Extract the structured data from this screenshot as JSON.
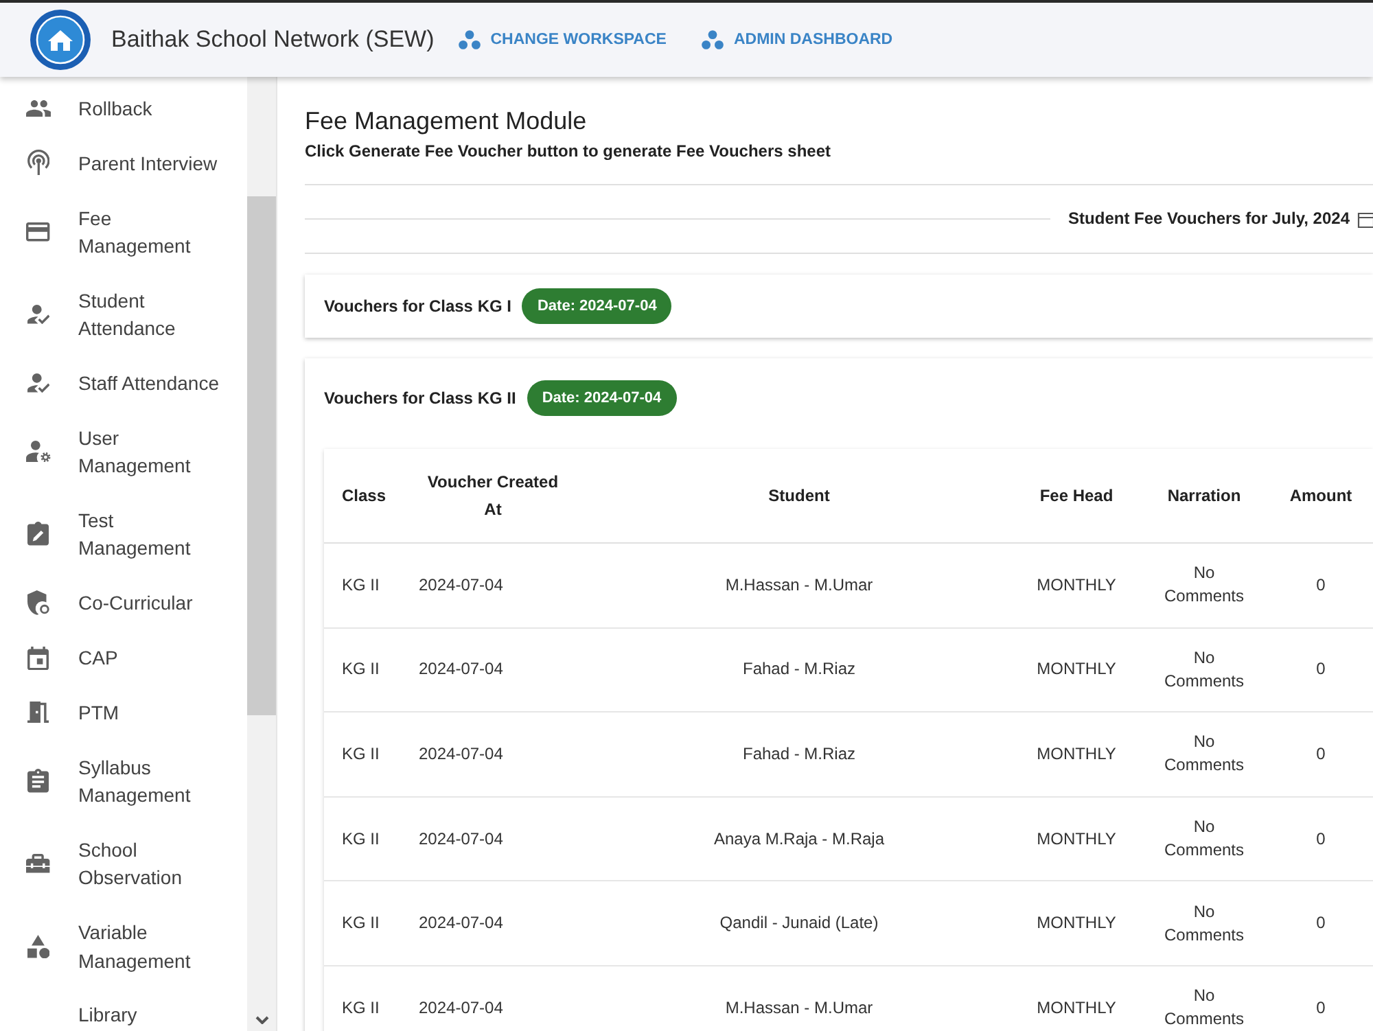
{
  "header": {
    "title": "Baithak School Network (SEW)",
    "actions": [
      {
        "label": "CHANGE WORKSPACE"
      },
      {
        "label": "ADMIN DASHBOARD"
      }
    ]
  },
  "sidebar": {
    "items": [
      {
        "label": "Rollback"
      },
      {
        "label": "Parent Interview"
      },
      {
        "label": "Fee Management"
      },
      {
        "label": "Student Attendance"
      },
      {
        "label": "Staff Attendance"
      },
      {
        "label": "User Management"
      },
      {
        "label": "Test Management"
      },
      {
        "label": "Co-Curricular"
      },
      {
        "label": "CAP"
      },
      {
        "label": "PTM"
      },
      {
        "label": "Syllabus Management"
      },
      {
        "label": "School Observation"
      },
      {
        "label": "Variable Management"
      },
      {
        "label": "Library"
      }
    ]
  },
  "page": {
    "title": "Fee Management Module",
    "subtitle": "Click Generate Fee Voucher button to generate Fee Vouchers sheet",
    "period_label": "Student Fee Vouchers for July, 2024"
  },
  "voucher_groups": [
    {
      "title": "Vouchers for Class KG I",
      "date": "Date: 2024-07-04"
    },
    {
      "title": "Vouchers for Class KG II",
      "date": "Date: 2024-07-04",
      "table": {
        "columns": [
          "Class",
          "Voucher Created At",
          "Student",
          "Fee Head",
          "Narration",
          "Amount"
        ],
        "rows": [
          [
            "KG II",
            "2024-07-04",
            "M.Hassan - M.Umar",
            "MONTHLY",
            "No Comments",
            "0"
          ],
          [
            "KG II",
            "2024-07-04",
            "Fahad - M.Riaz",
            "MONTHLY",
            "No Comments",
            "0"
          ],
          [
            "KG II",
            "2024-07-04",
            "Fahad - M.Riaz",
            "MONTHLY",
            "No Comments",
            "0"
          ],
          [
            "KG II",
            "2024-07-04",
            "Anaya M.Raja - M.Raja",
            "MONTHLY",
            "No Comments",
            "0"
          ],
          [
            "KG II",
            "2024-07-04",
            "Qandil - Junaid (Late)",
            "MONTHLY",
            "No Comments",
            "0"
          ],
          [
            "KG II",
            "2024-07-04",
            "M.Hassan - M.Umar",
            "MONTHLY",
            "No Comments",
            "0"
          ]
        ]
      }
    }
  ]
}
